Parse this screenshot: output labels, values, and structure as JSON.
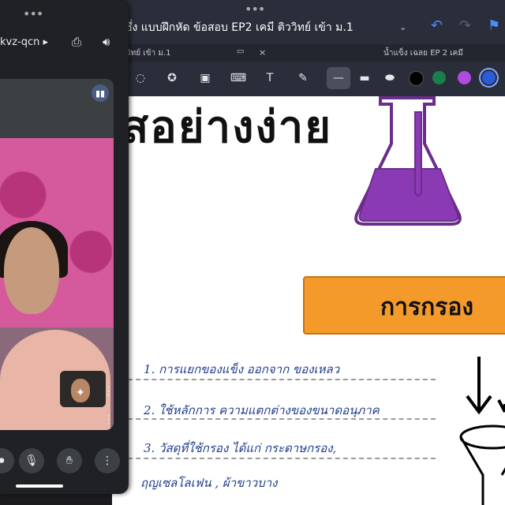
{
  "notes": {
    "title": "ซึ่ง แบบฝึกหัด ข้อสอบ EP2 เคมี ติววิทย์ เข้า ม.1",
    "title_chevron": "⌄",
    "tabs": [
      {
        "label": "วิทย์ เข้า ม.1"
      },
      {
        "label": "น้ำแข็ง เฉลย EP 2 เคมี"
      }
    ],
    "tab_close": "×",
    "colors": [
      "#ffffff",
      "#000000",
      "#1a7f4b",
      "#b04be0",
      "#2a5bd8"
    ]
  },
  "canvas": {
    "heading": "สอย่างง่าย",
    "box_label": "การกรอง",
    "lines": [
      "1. การแยกของแข็ง ออกจาก ของเหลว",
      "2. ใช้หลักการ ความแตกต่างของขนาดอนุภาค",
      "3. วัสดุที่ใช้กรอง ได้แก่ กระดาษกรอง,",
      "ฤญเซลโลเฟน , ผ้าขาวบาง"
    ]
  },
  "meet": {
    "handle": "•••",
    "code": "kvz-qcn ▸",
    "speaking_icon": "speaking-indicator-icon"
  }
}
